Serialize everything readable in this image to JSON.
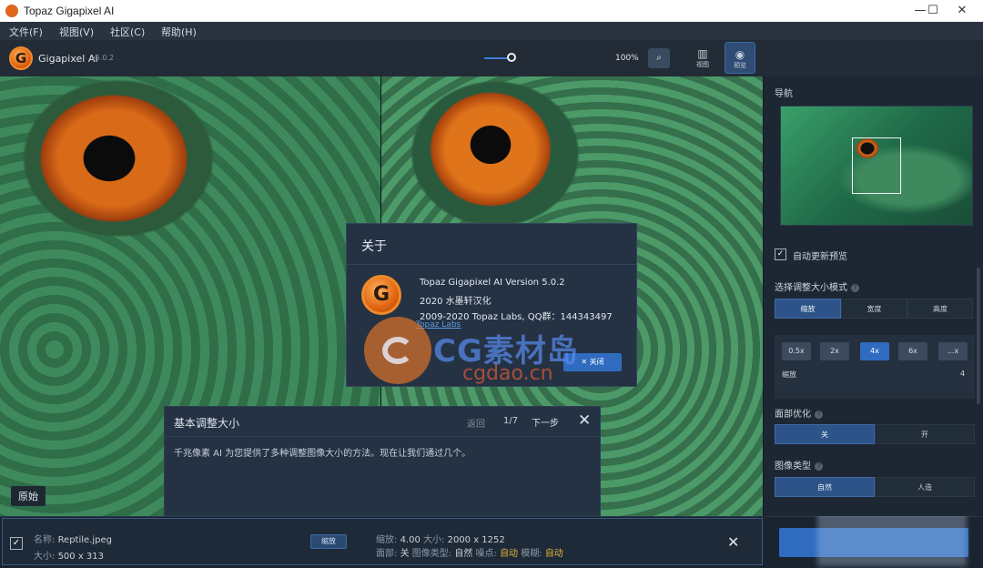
{
  "window": {
    "title": "Topaz Gigapixel AI",
    "minimize": "—",
    "maximize": "☐",
    "close": "✕"
  },
  "menu": [
    "文件(F)",
    "视图(V)",
    "社区(C)",
    "帮助(H)"
  ],
  "toolbar": {
    "logo_letter": "G",
    "app_name": "Gigapixel AI",
    "version": "v5.0.2",
    "zoom": "100%",
    "view_compare_label": "视图",
    "view_preview_label": "预览"
  },
  "image": {
    "original_label": "原始"
  },
  "about": {
    "title": "关于",
    "logo_letter": "G",
    "line1": "Topaz Gigapixel AI Version 5.0.2",
    "line2": "2020 水墨轩汉化",
    "line3": "2009-2020 Topaz Labs, QQ群：144343497",
    "link": "Topaz Labs",
    "close": "关闭"
  },
  "watermark": {
    "text1": "CG素材岛",
    "text2": "cgdao.cn"
  },
  "tutorial": {
    "title": "基本调整大小",
    "back": "返回",
    "page": "1/7",
    "next": "下一步",
    "body": "千兆像素 AI 为您提供了多种调整图像大小的方法。现在让我们通过几个。"
  },
  "file": {
    "name_label": "名称:",
    "name": "Reptile.jpeg",
    "size_label": "大小:",
    "size": "500 x 313",
    "scale_chip": "缩放",
    "info1_scale_label": "缩放:",
    "info1_scale": "4.00",
    "info1_size_label": "大小:",
    "info1_size": "2000 x 1252",
    "face_label": "面部:",
    "face": "关",
    "type_label": "图像类型:",
    "type": "自然",
    "noise_label": "噪点:",
    "noise": "自动",
    "blur_label": "模糊:",
    "blur": "自动"
  },
  "panel": {
    "nav_label": "导航",
    "auto_update": "自动更新预览",
    "mode_label": "选择调整大小模式",
    "mode_options": [
      "缩放",
      "宽度",
      "高度"
    ],
    "scale_options": [
      "0.5x",
      "2x",
      "4x",
      "6x",
      "...x"
    ],
    "scale_label": "缩放",
    "scale_value": "4",
    "face_label": "面部优化",
    "face_options": [
      "关",
      "开"
    ],
    "type_label": "图像类型",
    "type_options": [
      "自然",
      "人造"
    ]
  },
  "colors": {
    "accent": "#2f6cc0",
    "panel_bg": "#1d2733",
    "auto_value": "#e2b43a"
  }
}
